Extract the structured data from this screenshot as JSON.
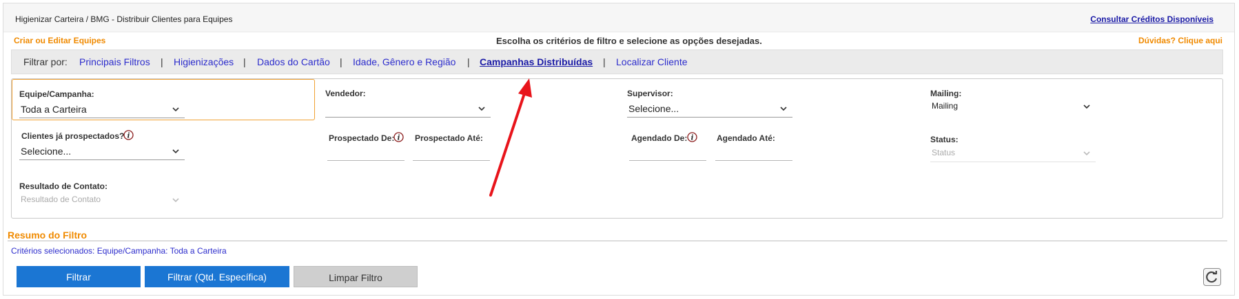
{
  "header": {
    "breadcrumb": "Higienizar Carteira / BMG - Distribuir Clientes para Equipes",
    "credits_link": "Consultar Créditos Disponíveis"
  },
  "subheader": {
    "left_link": "Criar ou Editar Equipes",
    "instruction": "Escolha os critérios de filtro e selecione as opções desejadas.",
    "help_link": "Dúvidas? Clique aqui"
  },
  "filterbar": {
    "label": "Filtrar por:",
    "separator": "|",
    "tabs": [
      {
        "label": "Principais Filtros"
      },
      {
        "label": "Higienizações"
      },
      {
        "label": "Dados do Cartão"
      },
      {
        "label": "Idade, Gênero e Região"
      },
      {
        "label": "Campanhas Distribuídas"
      },
      {
        "label": "Localizar Cliente"
      }
    ],
    "active_tab": "Campanhas Distribuídas"
  },
  "fields": {
    "equipe": {
      "label": "Equipe/Campanha:",
      "value": "Toda a Carteira"
    },
    "vendedor": {
      "label": "Vendedor:",
      "value": ""
    },
    "supervisor": {
      "label": "Supervisor:",
      "value": "Selecione..."
    },
    "mailing": {
      "label": "Mailing:",
      "value": "Mailing"
    },
    "prospectados": {
      "label": "Clientes já prospectados?",
      "value": "Selecione..."
    },
    "prospectado_de": {
      "label": "Prospectado De:"
    },
    "prospectado_ate": {
      "label": "Prospectado Até:"
    },
    "agendado_de": {
      "label": "Agendado De:"
    },
    "agendado_ate": {
      "label": "Agendado Até:"
    },
    "status": {
      "label": "Status:",
      "value": "Status"
    },
    "resultado": {
      "label": "Resultado de Contato:",
      "value": "Resultado de Contato"
    }
  },
  "summary": {
    "title": "Resumo do Filtro",
    "text": "Critérios selecionados: Equipe/Campanha: Toda a Carteira"
  },
  "buttons": {
    "filtrar": "Filtrar",
    "filtrar_qtd": "Filtrar (Qtd. Específica)",
    "limpar": "Limpar Filtro"
  },
  "colors": {
    "accent_orange": "#f08a00",
    "link_blue": "#2c2ccc",
    "button_blue": "#1b76d3",
    "annotation_red": "#e8141b"
  }
}
